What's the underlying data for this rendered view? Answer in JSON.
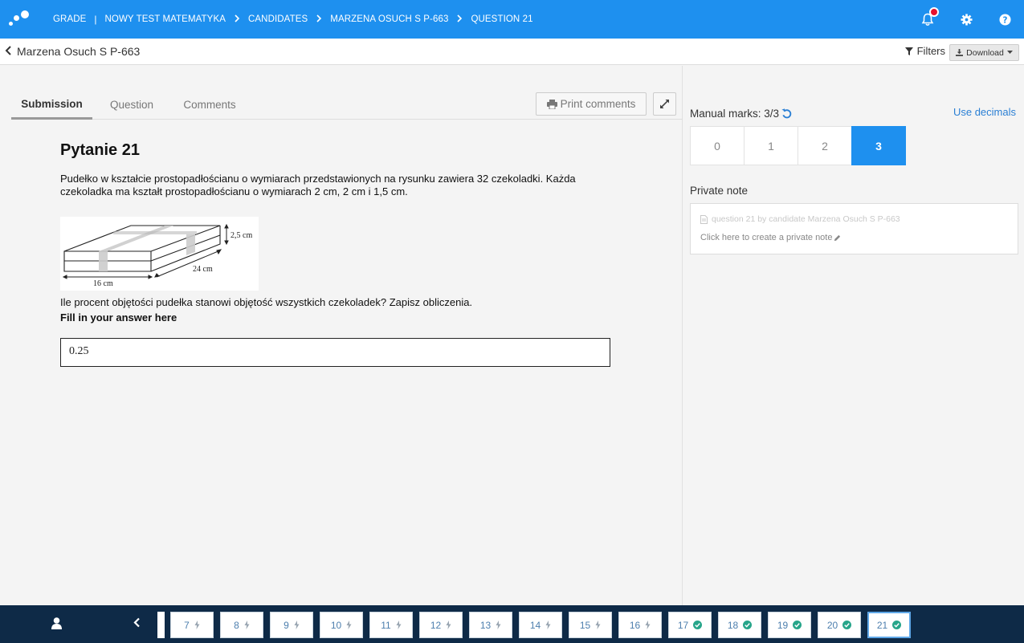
{
  "topbar": {
    "breadcrumbs": [
      "GRADE",
      "NOWY TEST MATEMATYKA",
      "CANDIDATES",
      "MARZENA OSUCH S P-663",
      "QUESTION 21"
    ],
    "first_sep": "|",
    "sep": ">",
    "icons": [
      "bell-icon",
      "gear-icon",
      "help-icon"
    ],
    "accent": "#1e90ef",
    "notification_dot": "#e8112d"
  },
  "subheader": {
    "back_label": "Marzena Osuch S P-663",
    "filters_label": "Filters",
    "download_label": "Download"
  },
  "tabs": [
    {
      "label": "Submission",
      "active": true
    },
    {
      "label": "Question",
      "active": false
    },
    {
      "label": "Comments",
      "active": false
    }
  ],
  "print_label": "Print comments",
  "question": {
    "title": "Pytanie 21",
    "text": "Pudełko w kształcie prostopadłościanu o wymiarach przedstawionych na rysunku zawiera 32 czekoladki. Każda czekoladka ma kształt prostopadłościanu o wymiarach 2 cm, 2 cm i 1,5 cm.",
    "figure_labels": {
      "height": "2,5 cm",
      "depth": "24 cm",
      "width": "16 cm"
    },
    "prompt": "Ile procent objętości pudełka stanowi objętość wszystkich czekoladek? Zapisz obliczenia.",
    "fill_label": "Fill in your answer here",
    "answer": "0.25"
  },
  "marks": {
    "label": "Manual marks: 3/3",
    "use_decimals": "Use decimals",
    "options": [
      "0",
      "1",
      "2",
      "3"
    ],
    "selected": "3"
  },
  "private_note": {
    "label": "Private note",
    "line1": "question 21 by candidate Marzena Osuch S P-663",
    "line2": "Click here to create a private note"
  },
  "bottom": {
    "questions": [
      {
        "n": "7",
        "status": "bolt"
      },
      {
        "n": "8",
        "status": "bolt"
      },
      {
        "n": "9",
        "status": "bolt"
      },
      {
        "n": "10",
        "status": "bolt"
      },
      {
        "n": "11",
        "status": "bolt"
      },
      {
        "n": "12",
        "status": "bolt"
      },
      {
        "n": "13",
        "status": "bolt"
      },
      {
        "n": "14",
        "status": "bolt"
      },
      {
        "n": "15",
        "status": "bolt"
      },
      {
        "n": "16",
        "status": "bolt"
      },
      {
        "n": "17",
        "status": "check"
      },
      {
        "n": "18",
        "status": "check"
      },
      {
        "n": "19",
        "status": "check"
      },
      {
        "n": "20",
        "status": "check"
      },
      {
        "n": "21",
        "status": "check"
      }
    ],
    "current": "21",
    "check_color": "#27a58a"
  }
}
